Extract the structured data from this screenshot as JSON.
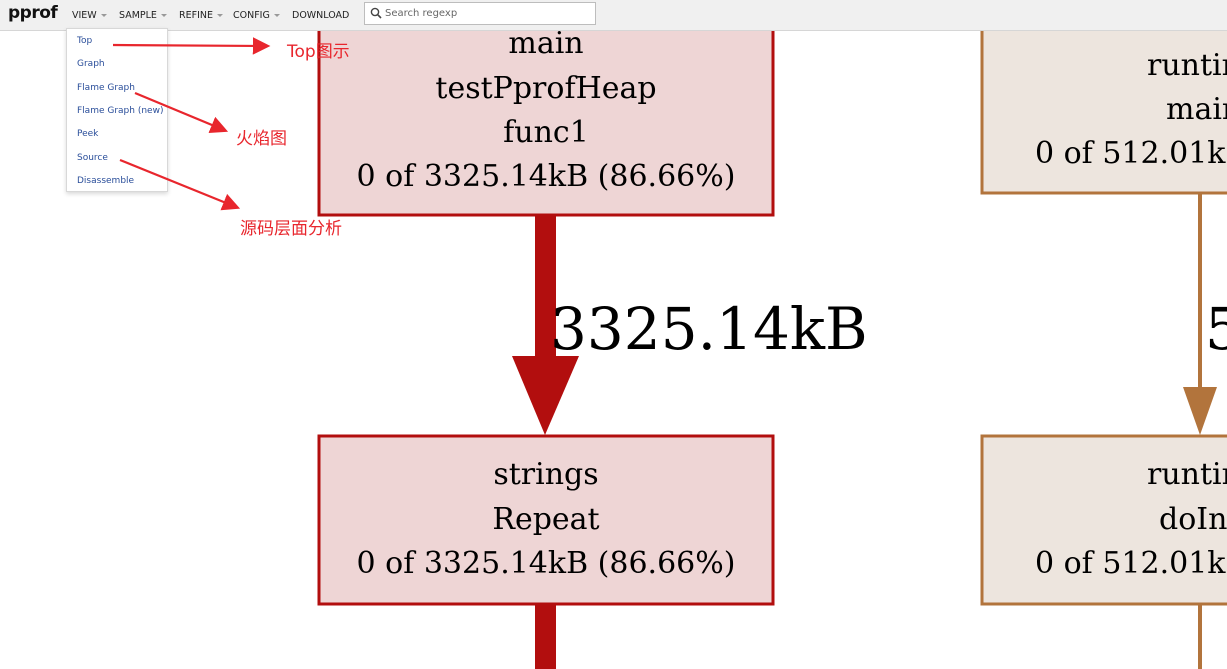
{
  "app": {
    "title": "pprof"
  },
  "menu": {
    "view": "VIEW",
    "sample": "SAMPLE",
    "refine": "REFINE",
    "config": "CONFIG",
    "download": "DOWNLOAD"
  },
  "search": {
    "placeholder": "Search regexp",
    "value": ""
  },
  "view_dropdown": {
    "items": [
      {
        "label": "Top"
      },
      {
        "label": "Graph"
      },
      {
        "label": "Flame Graph"
      },
      {
        "label": "Flame Graph (new)"
      },
      {
        "label": "Peek"
      },
      {
        "label": "Source"
      },
      {
        "label": "Disassemble"
      }
    ]
  },
  "annotations": {
    "top": "Top图示",
    "flame": "火焰图",
    "source": "源码层面分析"
  },
  "graph": {
    "node_main": {
      "line1": "main",
      "line2": "testPprofHeap",
      "line3": "func1",
      "line4": "0 of 3325.14kB (86.66%)"
    },
    "edge_main_strings": {
      "label": "3325.14kB"
    },
    "node_strings": {
      "line1": "strings",
      "line2": "Repeat",
      "line3": "0 of 3325.14kB (86.66%)"
    },
    "node_runtime_main": {
      "line1": "runtim",
      "line2": "mair",
      "line3": "0 of 512.01kB"
    },
    "edge_runtime": {
      "label": "5"
    },
    "node_runtime_doinit": {
      "line1": "runtim",
      "line2": "doIni",
      "line3": "0 of 512.01kB"
    },
    "colors": {
      "red_stroke": "#b20e0e",
      "red_fill": "#eed5d5",
      "brown_stroke": "#b2743c",
      "brown_fill": "#ede5de"
    }
  }
}
